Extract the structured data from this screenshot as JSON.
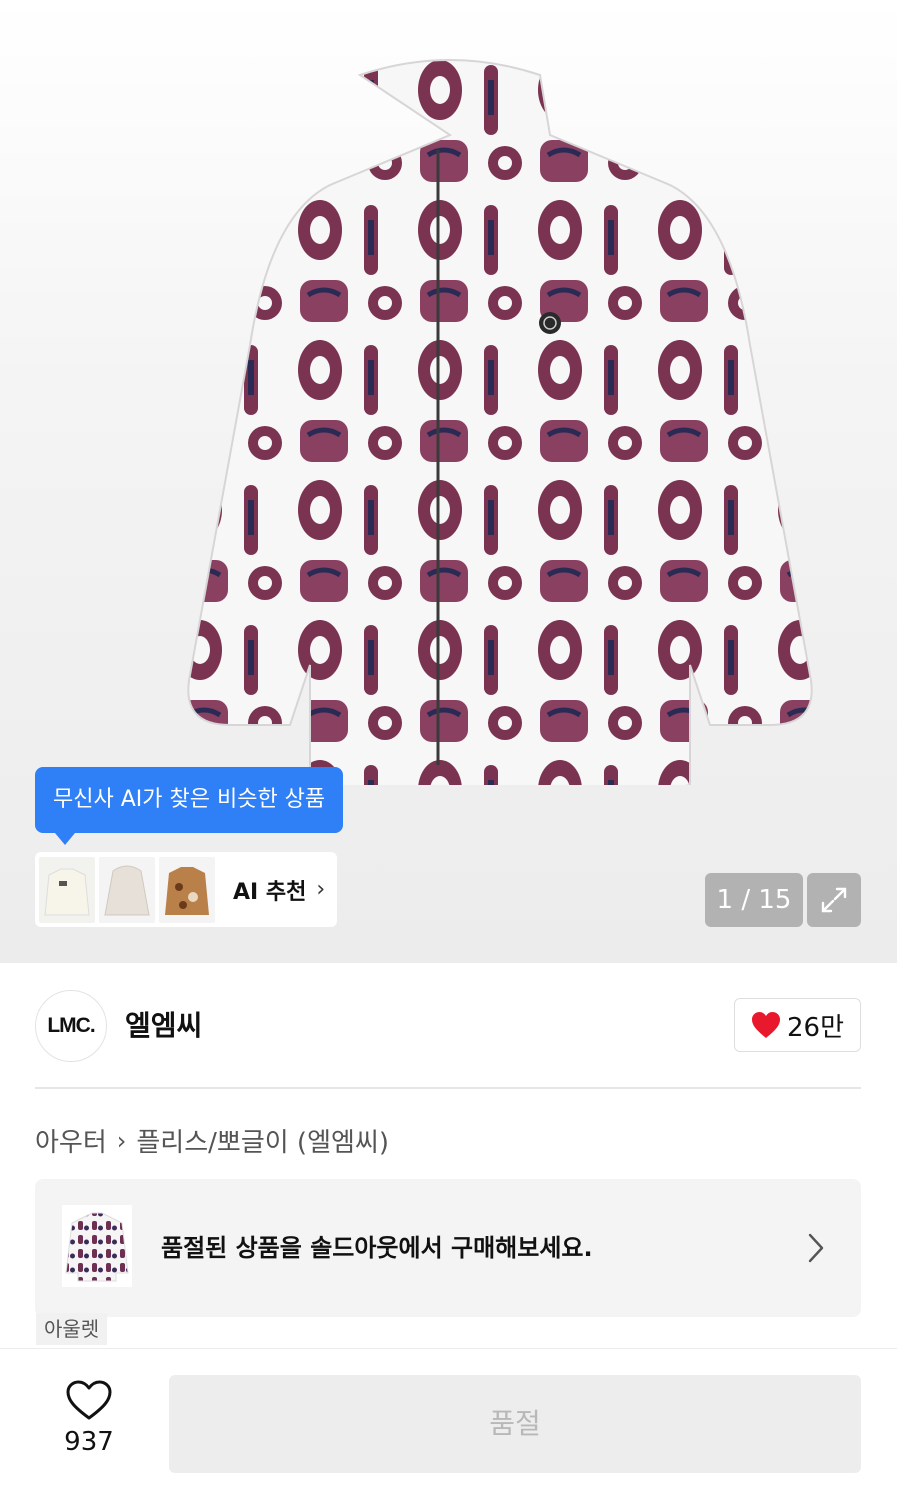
{
  "hero": {
    "ai_tooltip": "무신사 AI가 찾은 비슷한 상품",
    "ai_rec_label": "AI 추천",
    "counter": "1 / 15"
  },
  "brand": {
    "logo_text": "LMC.",
    "name": "엘엠씨",
    "likes": "26만"
  },
  "breadcrumb": {
    "category": "아우터",
    "subcategory": "플리스/뽀글이 (엘엠씨)"
  },
  "soldout_banner": {
    "text": "품절된 상품을 솔드아웃에서 구매해보세요."
  },
  "outlet_tag": "아울렛",
  "bottom_bar": {
    "wish_count": "937",
    "buy_label": "품절"
  },
  "colors": {
    "accent": "#2f7ff6",
    "heart": "#e8192c",
    "pattern_maroon": "#7a3350",
    "pattern_navy": "#2a2a55"
  }
}
